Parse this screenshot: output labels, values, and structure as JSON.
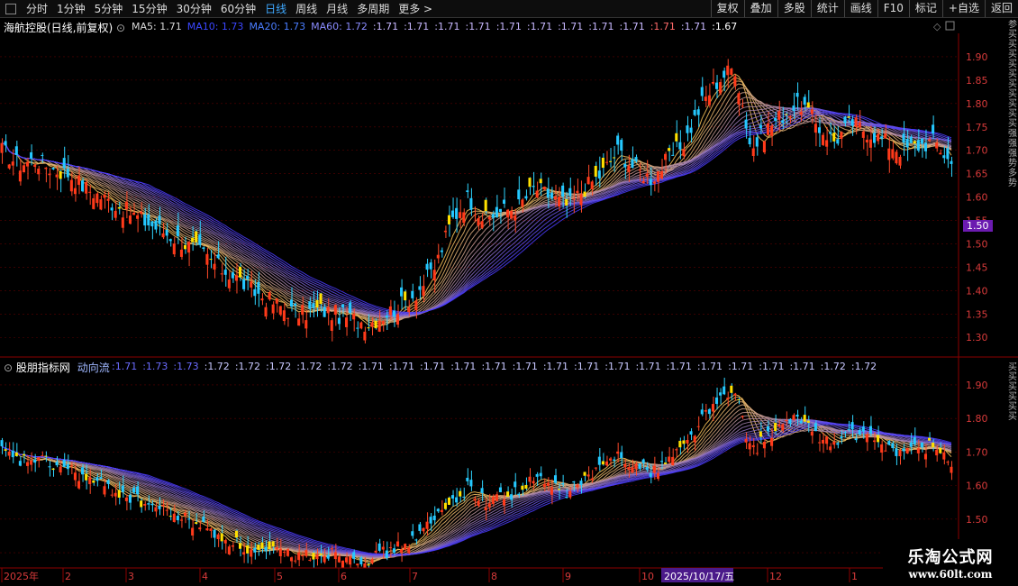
{
  "toolbar": {
    "items": [
      "分时",
      "1分钟",
      "5分钟",
      "15分钟",
      "30分钟",
      "60分钟",
      "日线",
      "周线",
      "月线",
      "多周期",
      "更多 >"
    ],
    "active": "日线",
    "right_buttons": [
      "复权",
      "叠加",
      "多股",
      "统计",
      "画线",
      "F10",
      "标记",
      "+自选",
      "返回"
    ]
  },
  "top_panel": {
    "title": "海航控股(日线,前复权)",
    "ma_labels": [
      {
        "text": "MA5: 1.71",
        "color": "#d8d8d8"
      },
      {
        "text": "MA10: 1.73",
        "color": "#3b46ff"
      },
      {
        "text": "MA20: 1.73",
        "color": "#4a7dff"
      },
      {
        "text": "MA60: 1.72",
        "color": "#8a8cff"
      }
    ],
    "extra_values": [
      ":1.71",
      ":1.71",
      ":1.71",
      ":1.71",
      ":1.71",
      ":1.71",
      ":1.71",
      ":1.71",
      ":1.71",
      ":1.71",
      ":1.71",
      ":1.67"
    ],
    "price_badge": "1.50"
  },
  "bottom_panel": {
    "title": "股朋指标网",
    "indicator_name": "动向流",
    "values": [
      ":1.71",
      ":1.73",
      ":1.73",
      ":1.72",
      ":1.72",
      ":1.72",
      ":1.72",
      ":1.72",
      ":1.71",
      ":1.71",
      ":1.71",
      ":1.71",
      ":1.71",
      ":1.71",
      ":1.71",
      ":1.71",
      ":1.71",
      ":1.71",
      ":1.71",
      ":1.71",
      ":1.71",
      ":1.71",
      ":1.71",
      ":1.72",
      ":1.72"
    ]
  },
  "chart_data": [
    {
      "type": "candlestick",
      "title": "海航控股(日线,前复权)",
      "ylim": [
        1.26,
        1.95
      ],
      "yticks": [
        1.3,
        1.35,
        1.4,
        1.45,
        1.5,
        1.55,
        1.6,
        1.65,
        1.7,
        1.75,
        1.8,
        1.85,
        1.9
      ],
      "series_close": [
        1.7,
        1.67,
        1.68,
        1.66,
        1.65,
        1.62,
        1.6,
        1.58,
        1.56,
        1.54,
        1.52,
        1.5,
        1.48,
        1.45,
        1.43,
        1.4,
        1.38,
        1.36,
        1.35,
        1.36,
        1.35,
        1.34,
        1.33,
        1.35,
        1.37,
        1.4,
        1.45,
        1.55,
        1.6,
        1.55,
        1.57,
        1.58,
        1.62,
        1.6,
        1.58,
        1.62,
        1.65,
        1.7,
        1.66,
        1.64,
        1.68,
        1.72,
        1.8,
        1.85,
        1.88,
        1.7,
        1.75,
        1.78,
        1.8,
        1.75,
        1.72,
        1.76,
        1.74,
        1.72,
        1.7,
        1.71,
        1.72,
        1.67
      ]
    },
    {
      "type": "candlestick",
      "title": "股朋指标网",
      "ylim": [
        1.36,
        1.94
      ],
      "yticks": [
        1.4,
        1.5,
        1.6,
        1.7,
        1.8,
        1.9
      ],
      "series_close": [
        1.7,
        1.67,
        1.68,
        1.66,
        1.65,
        1.62,
        1.6,
        1.58,
        1.56,
        1.54,
        1.52,
        1.5,
        1.48,
        1.45,
        1.43,
        1.4,
        1.4,
        1.4,
        1.39,
        1.4,
        1.4,
        1.39,
        1.38,
        1.4,
        1.42,
        1.45,
        1.5,
        1.55,
        1.6,
        1.55,
        1.57,
        1.58,
        1.62,
        1.6,
        1.58,
        1.62,
        1.65,
        1.7,
        1.66,
        1.64,
        1.68,
        1.72,
        1.8,
        1.85,
        1.88,
        1.7,
        1.75,
        1.78,
        1.8,
        1.75,
        1.72,
        1.76,
        1.74,
        1.72,
        1.7,
        1.71,
        1.72,
        1.67
      ]
    }
  ],
  "x_axis": {
    "labels": [
      "2025年",
      "2",
      "3",
      "4",
      "5",
      "6",
      "7",
      "8",
      "9",
      "10",
      "11",
      "12",
      "1"
    ],
    "highlight": "2025/10/17/五"
  },
  "watermark": {
    "line1": "乐淘公式网",
    "line2": "www.60lt.com"
  },
  "side_text_top": "参买买买买买买买买买买强强强势多势",
  "side_text_bottom": "买买买买买买"
}
